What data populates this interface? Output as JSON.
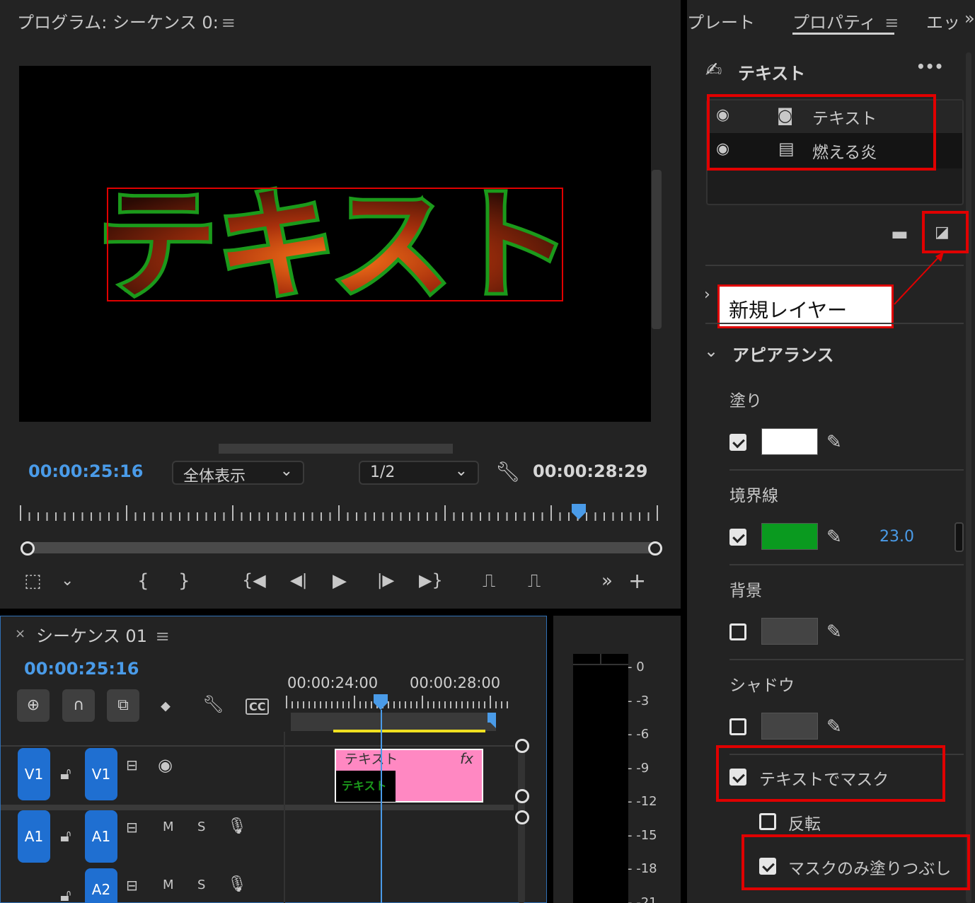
{
  "program": {
    "title": "プログラム: シーケンス 0:",
    "menu_glyph": "≡",
    "video_text": "テキスト",
    "timecode_current": "00:00:25:16",
    "zoom_label": "全体表示",
    "resolution_label": "1/2",
    "timecode_duration": "00:00:28:29",
    "playhead_position": 0.89
  },
  "sequence": {
    "title": "シーケンス 01",
    "close_glyph": "×",
    "menu_glyph": "≡",
    "timecode": "00:00:25:16",
    "ruler_labels": [
      "00:00:24:00",
      "00:00:28:00"
    ],
    "tracks": [
      {
        "id": "V1",
        "target": "V1"
      },
      {
        "id": "A1",
        "target": "A1",
        "m": "M",
        "s": "S"
      },
      {
        "id": "",
        "target": "A2",
        "m": "M",
        "s": "S"
      }
    ],
    "clip_label": "テキスト",
    "clip_fx": "fx"
  },
  "meter": {
    "db_labels": [
      "0",
      "-3",
      "-6",
      "-9",
      "-12",
      "-15",
      "-18",
      "-21"
    ]
  },
  "properties": {
    "tabs": [
      "プレート",
      "プロパティ",
      "エッ"
    ],
    "active_tab": "プロパティ",
    "menu_glyph": "≡",
    "more_glyph": "»",
    "object_title": "テキスト",
    "more_options": "•••",
    "layers": [
      {
        "name": "テキスト",
        "type": "text"
      },
      {
        "name": "燃える炎",
        "type": "video"
      }
    ],
    "new_layer_callout": "新規レイヤー",
    "appearance_title": "アピアランス",
    "fill_label": "塗り",
    "fill_color": "#ffffff",
    "stroke_label": "境界線",
    "stroke_color": "#0a9a1f",
    "stroke_width": "23.0",
    "background_label": "背景",
    "shadow_label": "シャドウ",
    "mask_label": "テキストでマスク",
    "invert_label": "反転",
    "fill_mask_label": "マスクのみ塗りつぶし"
  },
  "colors": {
    "accent_blue": "#4a9be8",
    "track_blue": "#1f6fd1",
    "clip_pink": "#ff88c2",
    "annotation_red": "#e00000"
  }
}
